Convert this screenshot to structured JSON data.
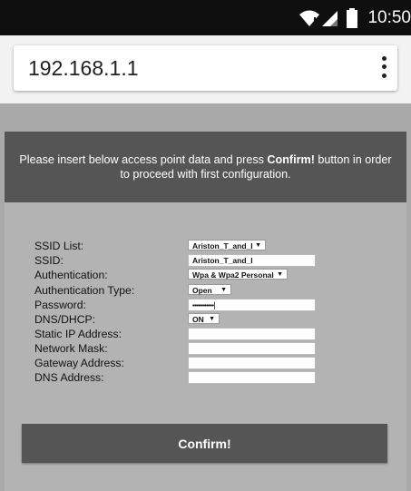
{
  "status_bar": {
    "time": "10:50",
    "icons": [
      "wifi-alert-icon",
      "signal-icon",
      "battery-icon"
    ]
  },
  "browser": {
    "url": "192.168.1.1",
    "menu_icon": "more-vert-icon"
  },
  "notice": {
    "text_before": "Please insert below access point data and press ",
    "bold": "Confirm!",
    "text_after": " button in order to proceed with first configuration."
  },
  "form": {
    "ssid_list": {
      "label": "SSID List:",
      "value": "Ariston_T_and_I"
    },
    "ssid": {
      "label": "SSID:",
      "value": "Ariston_T_and_I"
    },
    "authentication": {
      "label": "Authentication:",
      "value": "Wpa & Wpa2 Personal"
    },
    "authentication_type": {
      "label": "Authentication Type:",
      "value": "Open"
    },
    "password": {
      "label": "Password:",
      "value": "••••••••••••"
    },
    "dns_dhcp": {
      "label": "DNS/DHCP:",
      "value": "ON"
    },
    "static_ip": {
      "label": "Static IP Address:",
      "value": ""
    },
    "network_mask": {
      "label": "Network Mask:",
      "value": ""
    },
    "gateway": {
      "label": "Gateway Address:",
      "value": ""
    },
    "dns_address": {
      "label": "DNS Address:",
      "value": ""
    }
  },
  "confirm_label": "Confirm!",
  "colors": {
    "notice_bg": "#555555",
    "button_bg": "#555555",
    "page_bg": "#a9a9a9",
    "panel_bg": "#b3b3b3"
  }
}
